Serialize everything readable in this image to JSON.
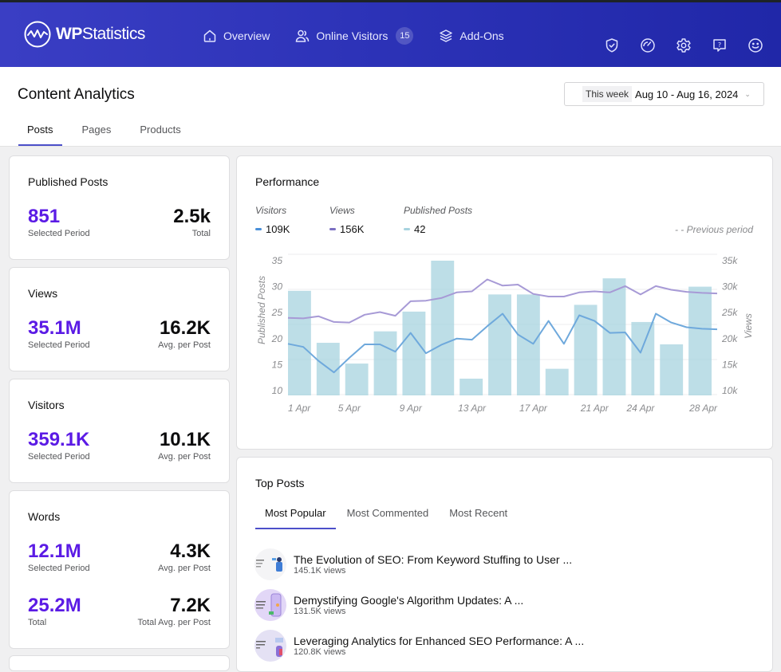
{
  "app": {
    "brand": {
      "prefix": "WP",
      "suffix": "Statistics"
    },
    "nav": [
      {
        "label": "Overview",
        "icon": "home-icon"
      },
      {
        "label": "Online Visitors",
        "icon": "users-icon",
        "badge": "15"
      },
      {
        "label": "Add-Ons",
        "icon": "layers-icon"
      }
    ],
    "header_icons": [
      "shield-check-icon",
      "speedometer-icon",
      "gear-icon",
      "help-chat-icon",
      "smiley-icon"
    ]
  },
  "page": {
    "title": "Content Analytics",
    "date_picker": {
      "preset": "This week",
      "range": "Aug 10 - Aug 16, 2024"
    },
    "tabs": [
      {
        "label": "Posts",
        "active": true
      },
      {
        "label": "Pages",
        "active": false
      },
      {
        "label": "Products",
        "active": false
      }
    ]
  },
  "kpis": [
    {
      "title": "Published Posts",
      "rows": [
        {
          "left_value": "851",
          "left_label": "Selected Period",
          "right_value": "2.5k",
          "right_label": "Total"
        }
      ]
    },
    {
      "title": "Views",
      "rows": [
        {
          "left_value": "35.1M",
          "left_label": "Selected Period",
          "right_value": "16.2K",
          "right_label": "Avg. per Post"
        }
      ]
    },
    {
      "title": "Visitors",
      "rows": [
        {
          "left_value": "359.1K",
          "left_label": "Selected Period",
          "right_value": "10.1K",
          "right_label": "Avg. per Post"
        }
      ]
    },
    {
      "title": "Words",
      "rows": [
        {
          "left_value": "12.1M",
          "left_label": "Selected Period",
          "right_value": "4.3K",
          "right_label": "Avg. per Post"
        },
        {
          "left_value": "25.2M",
          "left_label": "Total",
          "right_value": "7.2K",
          "right_label": "Total Avg. per Post"
        }
      ]
    }
  ],
  "performance": {
    "title": "Performance",
    "legend": [
      {
        "label": "Visitors",
        "value": "109K",
        "color": "#5b9bd5"
      },
      {
        "label": "Views",
        "value": "156K",
        "color": "#8a7fc8"
      },
      {
        "label": "Published Posts",
        "value": "42",
        "color": "#a7d3df"
      }
    ],
    "previous_period_label": "- - Previous period"
  },
  "chart_data": {
    "type": "bar",
    "title": "Performance",
    "xlabel": "",
    "ylabel": "Published Posts",
    "y2label": "Views",
    "ylim": [
      10,
      35
    ],
    "y2lim": [
      10,
      35
    ],
    "yticks": [
      "10",
      "15",
      "20",
      "25",
      "30",
      "35"
    ],
    "y2ticks": [
      "10k",
      "15k",
      "20k",
      "25k",
      "30k",
      "35k"
    ],
    "xticks": [
      "1 Apr",
      "5 Apr",
      "9 Apr",
      "13 Apr",
      "17 Apr",
      "21 Apr",
      "24 Apr",
      "28 Apr"
    ],
    "grid": true,
    "bars": {
      "name": "Published Posts",
      "color": "#a7d3df",
      "values": [
        29.2,
        19.2,
        15.2,
        21.4,
        25.2,
        35.0,
        12.3,
        28.5,
        28.5,
        14.2,
        26.5,
        31.6,
        23.2,
        18.9,
        30.0
      ]
    },
    "series": [
      {
        "name": "Views",
        "axis": "right",
        "unit": "k",
        "color": "#a79ad6",
        "values": [
          24.0,
          23.9,
          24.3,
          23.2,
          23.1,
          24.6,
          25.1,
          24.4,
          27.2,
          27.3,
          27.8,
          28.9,
          29.1,
          31.4,
          30.2,
          30.4,
          28.6,
          28.1,
          28.1,
          28.9,
          29.1,
          28.9,
          30.1,
          28.5,
          30.1,
          29.4,
          29.0,
          28.8,
          28.7
        ]
      },
      {
        "name": "Visitors",
        "axis": "right",
        "unit": "k",
        "color": "#6fa9dc",
        "values": [
          19.0,
          18.4,
          15.7,
          13.5,
          16.3,
          18.9,
          18.9,
          17.5,
          21.1,
          17.2,
          18.8,
          20.0,
          19.8,
          22.4,
          24.8,
          20.8,
          19.0,
          23.4,
          19.0,
          24.5,
          23.4,
          21.1,
          21.2,
          17.3,
          24.8,
          23.1,
          22.2,
          21.9,
          21.8
        ]
      }
    ],
    "legend_position": "top-left"
  },
  "top_posts": {
    "title": "Top Posts",
    "tabs": [
      {
        "label": "Most Popular",
        "active": true
      },
      {
        "label": "Most Commented",
        "active": false
      },
      {
        "label": "Most Recent",
        "active": false
      }
    ],
    "posts": [
      {
        "title": "The Evolution of SEO: From Keyword Stuffing to User ...",
        "views": "145.1K views",
        "thumb_bg": "#f4f4f6"
      },
      {
        "title": "Demystifying Google's Algorithm Updates: A ...",
        "views": "131.5K views",
        "thumb_bg": "#e2d7f7"
      },
      {
        "title": "Leveraging Analytics for Enhanced SEO Performance: A ...",
        "views": "120.8K views",
        "thumb_bg": "#e4e1f4"
      }
    ]
  }
}
